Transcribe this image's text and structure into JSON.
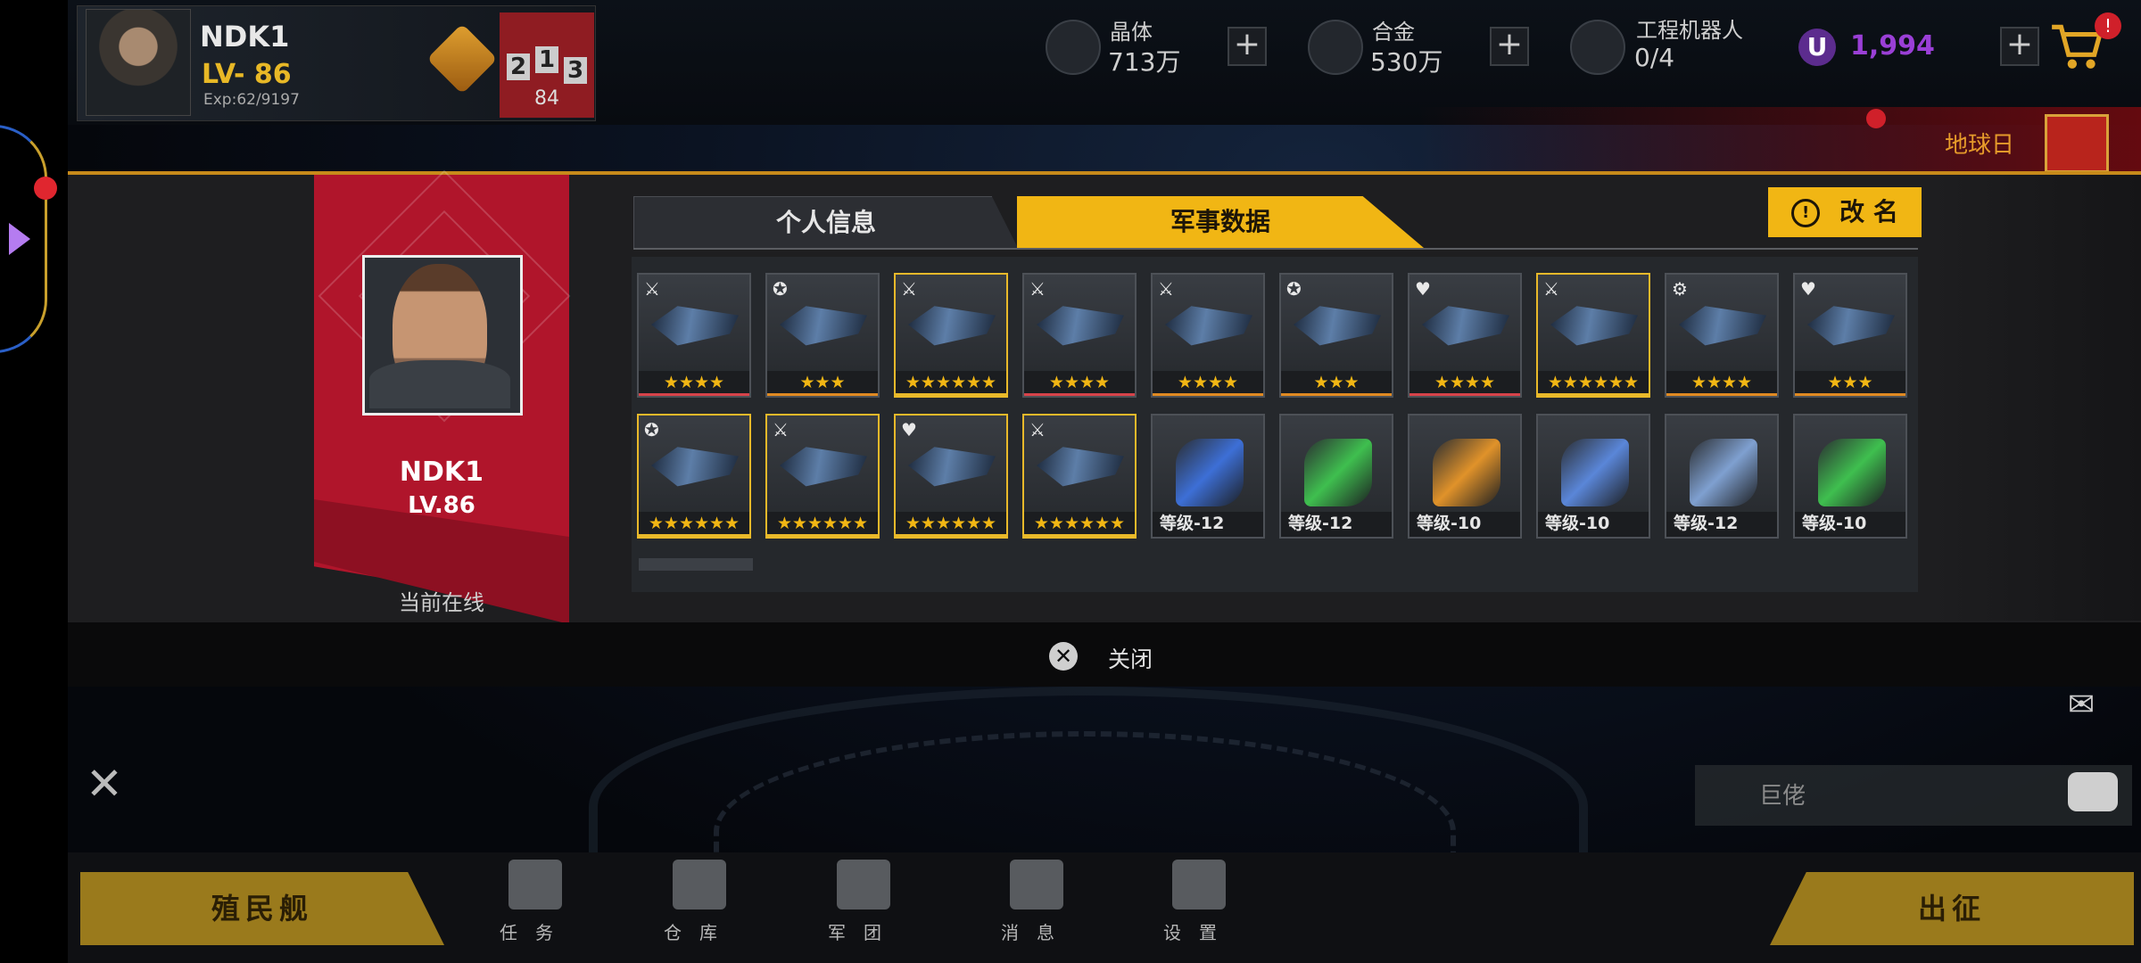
{
  "player": {
    "name": "NDK1",
    "level_text": "LV- 86",
    "exp_text": "Exp:62/9197",
    "rank": "84",
    "podium_digits": [
      "2",
      "1",
      "3"
    ]
  },
  "resources": [
    {
      "label": "晶体",
      "value": "713万",
      "icon": "crystal-icon"
    },
    {
      "label": "合金",
      "value": "530万",
      "icon": "alloy-icon"
    },
    {
      "label": "工程机器人",
      "value": "0/4",
      "icon": "robot-icon"
    }
  ],
  "currency": {
    "badge": "U",
    "value": "1,994"
  },
  "plus": "+",
  "notice": "!",
  "event": {
    "label": "地球日"
  },
  "profile_card": {
    "name": "NDK1",
    "level": "LV.86",
    "status": "当前在线"
  },
  "tabs": {
    "personal": "个人信息",
    "military": "军事数据"
  },
  "rename": {
    "label": "改 名",
    "icon_glyph": "!"
  },
  "colors": {
    "accent": "#f1b614",
    "banner": "#b0152b",
    "star": "#f1b614"
  },
  "slots_row1": [
    {
      "kind": "ship",
      "stars": "★★★★",
      "bar": "#d7434a",
      "gold": false,
      "icon": "⚔"
    },
    {
      "kind": "ship",
      "stars": "★★★",
      "bar": "#e08a22",
      "gold": false,
      "icon": "✪"
    },
    {
      "kind": "ship",
      "stars": "★★★★★★",
      "bar": "#e9b92a",
      "gold": true,
      "icon": "⚔"
    },
    {
      "kind": "ship",
      "stars": "★★★★",
      "bar": "#d7434a",
      "gold": false,
      "icon": "⚔"
    },
    {
      "kind": "ship",
      "stars": "★★★★",
      "bar": "#e08a22",
      "gold": false,
      "icon": "⚔"
    },
    {
      "kind": "ship",
      "stars": "★★★",
      "bar": "#e08a22",
      "gold": false,
      "icon": "✪"
    },
    {
      "kind": "ship",
      "stars": "★★★★",
      "bar": "#d7434a",
      "gold": false,
      "icon": "♥"
    },
    {
      "kind": "ship",
      "stars": "★★★★★★",
      "bar": "#e9b92a",
      "gold": true,
      "icon": "⚔"
    },
    {
      "kind": "ship",
      "stars": "★★★★",
      "bar": "#e08a22",
      "gold": false,
      "icon": "⚙"
    },
    {
      "kind": "ship",
      "stars": "★★★",
      "bar": "#e08a22",
      "gold": false,
      "icon": "♥"
    }
  ],
  "slots_row2": [
    {
      "kind": "ship",
      "stars": "★★★★★★",
      "bar": "#e9b92a",
      "gold": true,
      "icon": "✪"
    },
    {
      "kind": "ship",
      "stars": "★★★★★★",
      "bar": "#e9b92a",
      "gold": true,
      "icon": "⚔"
    },
    {
      "kind": "ship",
      "stars": "★★★★★★",
      "bar": "#e9b92a",
      "gold": true,
      "icon": "♥"
    },
    {
      "kind": "ship",
      "stars": "★★★★★★",
      "bar": "#e9b92a",
      "gold": true,
      "icon": "⚔"
    },
    {
      "kind": "part",
      "level": "等级-12",
      "color": "#3d6fd6"
    },
    {
      "kind": "part",
      "level": "等级-12",
      "color": "#3fbf4f"
    },
    {
      "kind": "part",
      "level": "等级-10",
      "color": "#e0922a"
    },
    {
      "kind": "part",
      "level": "等级-10",
      "color": "#5a86d8"
    },
    {
      "kind": "part",
      "level": "等级-12",
      "color": "#7fa0d0"
    },
    {
      "kind": "part",
      "level": "等级-10",
      "color": "#3fbf4f"
    }
  ],
  "close": {
    "label": "关闭",
    "glyph": "✕"
  },
  "chat": {
    "placeholder": "巨佬"
  },
  "hud": {
    "colony": "殖民舰",
    "expedition": "出征",
    "nav": [
      {
        "label": "任务",
        "icon": "task-icon"
      },
      {
        "label": "仓库",
        "icon": "warehouse-icon"
      },
      {
        "label": "军团",
        "icon": "legion-icon"
      },
      {
        "label": "消息",
        "icon": "message-icon"
      },
      {
        "label": "设置",
        "icon": "settings-icon"
      }
    ]
  }
}
